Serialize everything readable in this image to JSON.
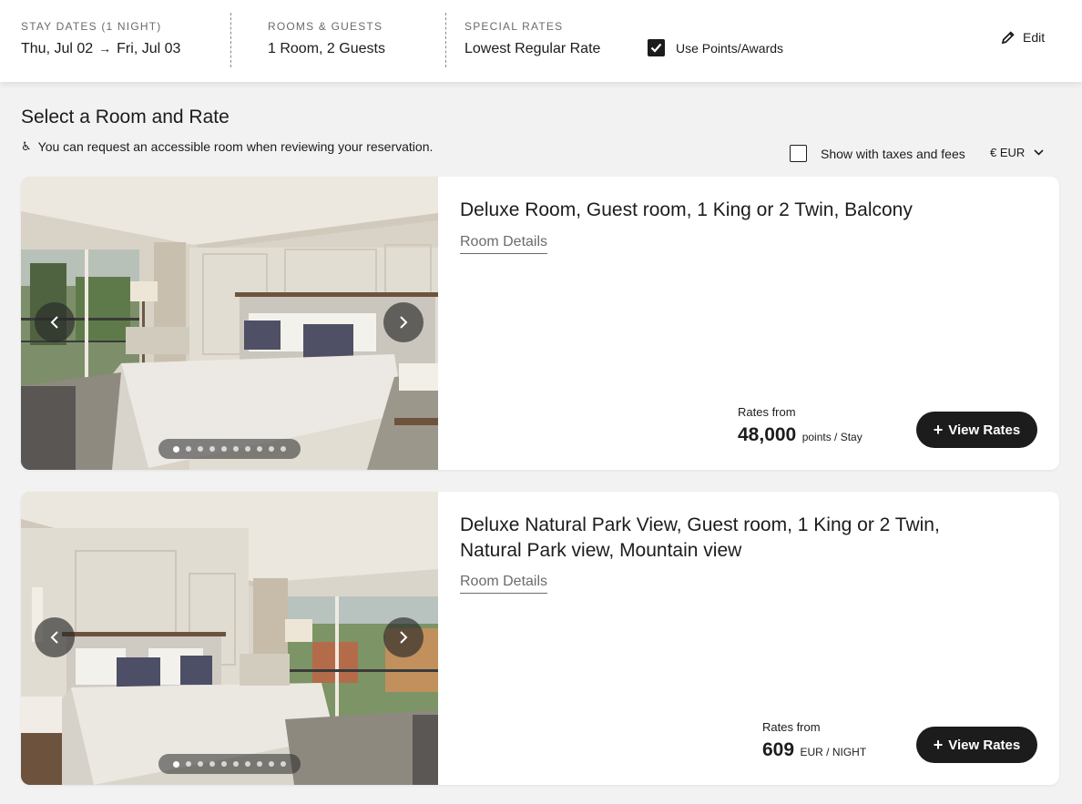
{
  "header": {
    "stay_dates": {
      "label": "STAY DATES (1 NIGHT)",
      "check_in": "Thu, Jul 02",
      "check_out": "Fri, Jul 03"
    },
    "rooms_guests": {
      "label": "ROOMS & GUESTS",
      "value": "1 Room, 2 Guests"
    },
    "special_rates": {
      "label": "SPECIAL RATES",
      "value": "Lowest Regular Rate"
    },
    "use_points": {
      "label": "Use Points/Awards",
      "checked": true
    },
    "edit_label": "Edit"
  },
  "main": {
    "title": "Select a Room and Rate",
    "accessible_note": "You can request an accessible room when reviewing your reservation.",
    "show_taxes": {
      "label": "Show with taxes and fees",
      "checked": false
    },
    "currency": "€ EUR"
  },
  "rooms": [
    {
      "title": "Deluxe Room, Guest room, 1 King or 2 Twin, Balcony",
      "details_link": "Room Details",
      "rates_from_label": "Rates from",
      "price": "48,000",
      "price_unit": "points / Stay",
      "view_rates_label": "View Rates",
      "photo_count": 10,
      "active_photo": 1
    },
    {
      "title": "Deluxe Natural Park View, Guest room, 1 King or 2 Twin, Natural Park view, Mountain view",
      "details_link": "Room Details",
      "rates_from_label": "Rates from",
      "price": "609",
      "price_unit": "EUR / NIGHT",
      "view_rates_label": "View Rates",
      "photo_count": 10,
      "active_photo": 1
    }
  ],
  "icons": {
    "check": "check-icon",
    "arrow": "arrow-right-icon",
    "edit": "pencil-icon",
    "accessible": "wheelchair-icon",
    "chevron": "chevron-down-icon"
  }
}
